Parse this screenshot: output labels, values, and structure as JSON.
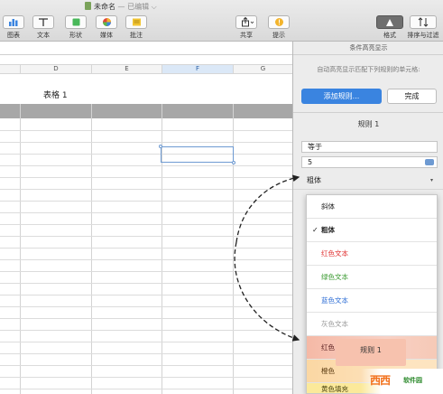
{
  "window": {
    "doc_name": "未命名",
    "doc_status": "— 已编辑",
    "status_caret": "⌵"
  },
  "toolbar": {
    "left": [
      {
        "label": "图表",
        "icon": "chart-icon"
      },
      {
        "label": "文本",
        "icon": "text-icon"
      },
      {
        "label": "形状",
        "icon": "shape-icon"
      },
      {
        "label": "媒体",
        "icon": "media-icon"
      },
      {
        "label": "批注",
        "icon": "comment-icon"
      }
    ],
    "share_label": "共享",
    "tips_label": "提示",
    "format_label": "格式",
    "sort_filter_label": "排序与过滤"
  },
  "sheet": {
    "columns": [
      "D",
      "E",
      "F",
      "G"
    ],
    "selected_column": "F",
    "table_title": "表格 1"
  },
  "inspector": {
    "panel_title": "条件高亮显示",
    "description": "自动高亮显示匹配下列规则的单元格:",
    "add_rule_label": "添加规则...",
    "done_label": "完成",
    "rule_title": "规则 1",
    "condition_value": "等于",
    "input_value": "5",
    "style_value": "粗体",
    "style_caret": "▾"
  },
  "style_menu": {
    "items": [
      {
        "label": "斜体",
        "checked": false
      },
      {
        "label": "粗体",
        "checked": true
      },
      {
        "label": "红色文本",
        "checked": false
      },
      {
        "label": "绿色文本",
        "checked": false
      },
      {
        "label": "蓝色文本",
        "checked": false
      },
      {
        "label": "灰色文本",
        "checked": false
      },
      {
        "label": "红色",
        "checked": false
      },
      {
        "label": "橙色",
        "checked": false
      },
      {
        "label": "黄色填充",
        "checked": false
      }
    ],
    "check_mark": "✓"
  },
  "overlay": {
    "rule_badge": "规则 1"
  },
  "watermark": {
    "logo_text": "西西",
    "sub_text": "软件园"
  },
  "colors": {
    "accent_blue": "#3a84e0",
    "selection_blue": "#6e9ad2",
    "red_text": "#e03030",
    "green_text": "#3a9a30",
    "blue_text": "#2f6fd6",
    "gray_text": "#9a9a9a"
  }
}
